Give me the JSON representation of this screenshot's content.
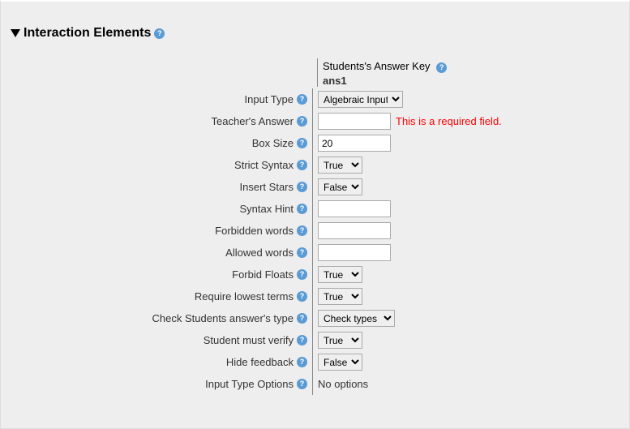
{
  "section": {
    "title": "Interaction Elements"
  },
  "answerKey": {
    "label": "Students's Answer Key",
    "name": "ans1"
  },
  "fields": {
    "inputType": {
      "label": "Input Type",
      "value": "Algebraic Input"
    },
    "teachersAnswer": {
      "label": "Teacher's Answer",
      "value": "",
      "error": "This is a required field."
    },
    "boxSize": {
      "label": "Box Size",
      "value": "20"
    },
    "strictSyntax": {
      "label": "Strict Syntax",
      "value": "True"
    },
    "insertStars": {
      "label": "Insert Stars",
      "value": "False"
    },
    "syntaxHint": {
      "label": "Syntax Hint",
      "value": ""
    },
    "forbiddenWords": {
      "label": "Forbidden words",
      "value": ""
    },
    "allowedWords": {
      "label": "Allowed words",
      "value": ""
    },
    "forbidFloats": {
      "label": "Forbid Floats",
      "value": "True"
    },
    "requireLowest": {
      "label": "Require lowest terms",
      "value": "True"
    },
    "checkType": {
      "label": "Check Students answer's type",
      "value": "Check types"
    },
    "mustVerify": {
      "label": "Student must verify",
      "value": "True"
    },
    "hideFeedback": {
      "label": "Hide feedback",
      "value": "False"
    },
    "inputTypeOptions": {
      "label": "Input Type Options",
      "value": "No options"
    }
  }
}
